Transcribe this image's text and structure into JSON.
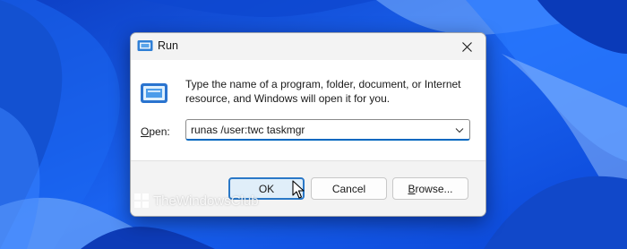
{
  "window": {
    "title": "Run"
  },
  "dialog": {
    "description": "Type the name of a program, folder, document, or Internet resource, and Windows will open it for you.",
    "open_label_mnemonic": "O",
    "open_label_rest": "pen:",
    "command_value": "runas /user:twc taskmgr"
  },
  "buttons": {
    "ok": "OK",
    "cancel": "Cancel",
    "browse_mnemonic": "B",
    "browse_rest": "rowse..."
  },
  "watermark": {
    "text": "TheWindowsClub"
  },
  "icons": {
    "title": "run-icon",
    "close": "close-icon",
    "dropdown": "chevron-down-icon",
    "cursor": "mouse-pointer-icon",
    "watermark": "thewindowsclub-logo"
  },
  "colors": {
    "accent": "#0067c0",
    "ok_border": "#2a78c7",
    "wallpaper_base": "#1555e4"
  }
}
